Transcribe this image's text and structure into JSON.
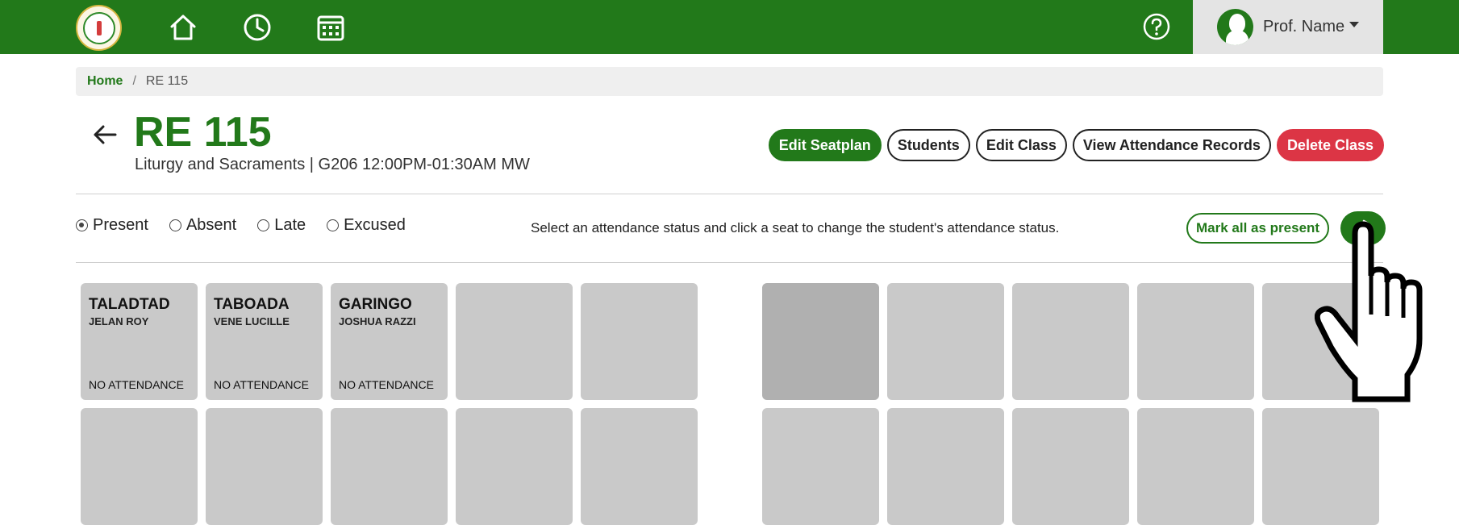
{
  "topbar": {
    "nav_icons": [
      "home-icon",
      "clock-icon",
      "calendar-icon"
    ],
    "help_icon": "question-circle-icon",
    "profile_name": "Prof. Name",
    "colors": {
      "brand": "#22791a",
      "profile_bg": "#e4e4e4"
    }
  },
  "breadcrumb": {
    "home": "Home",
    "separator": "/",
    "current": "RE 115"
  },
  "class": {
    "title": "RE 115",
    "subtitle": "Liturgy and Sacraments | G206 12:00PM-01:30AM MW"
  },
  "actions": {
    "edit_seatplan": "Edit Seatplan",
    "students": "Students",
    "edit_class": "Edit Class",
    "view_records": "View Attendance Records",
    "delete_class": "Delete Class"
  },
  "attendance": {
    "options": [
      {
        "label": "Present",
        "checked": true
      },
      {
        "label": "Absent",
        "checked": false
      },
      {
        "label": "Late",
        "checked": false
      },
      {
        "label": "Excused",
        "checked": false
      }
    ],
    "instruction": "Select an attendance status and click a seat to change the student's attendance status.",
    "mark_all": "Mark all as present",
    "refresh_icon": "refresh-icon"
  },
  "seats": [
    {
      "last": "TALADTAD",
      "first": "JELAN ROY",
      "status": "NO ATTENDANCE"
    },
    {
      "last": "TABOADA",
      "first": "VENE LUCILLE",
      "status": "NO ATTENDANCE"
    },
    {
      "last": "GARINGO",
      "first": "JOSHUA RAZZI",
      "status": "NO ATTENDANCE"
    }
  ],
  "colors": {
    "accent": "#22791a",
    "danger": "#dc3545",
    "seat": "#c9c9c9",
    "seat_selected": "#b0b0b0"
  }
}
